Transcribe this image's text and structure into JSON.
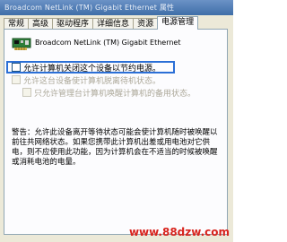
{
  "window": {
    "title": "Broadcom NetLink (TM) Gigabit Ethernet 属性"
  },
  "tabs": [
    {
      "label": "常规"
    },
    {
      "label": "高级"
    },
    {
      "label": "驱动程序"
    },
    {
      "label": "详细信息"
    },
    {
      "label": "资源"
    },
    {
      "label": "电源管理",
      "active": true
    }
  ],
  "device": {
    "name": "Broadcom NetLink (TM) Gigabit Ethernet",
    "icon": "network-adapter-icon"
  },
  "options": [
    {
      "label": "允许计算机关闭这个设备以节约电源。",
      "checked": false,
      "enabled": true
    },
    {
      "label": "允许这台设备使计算机脱离待机状态。",
      "checked": false,
      "enabled": false
    },
    {
      "label": "只允许管理台计算机唤醒计算机的备用状态。",
      "checked": false,
      "enabled": false
    }
  ],
  "warning": "警告：允许此设备离开等待状态可能会使计算机随时被唤醒以前往共网络状态。如果您携带此计算机出差或用电池对它供电，则不应使用此功能，因为计算机会在不适当的时候被唤醒或消耗电池的电量。",
  "watermark": "www.88dzw.com",
  "colors": {
    "titlebar": "#4f7cb8",
    "dialog_bg": "#ece9d8",
    "highlight": "#2b6fd6",
    "watermark": "#d8231c"
  }
}
